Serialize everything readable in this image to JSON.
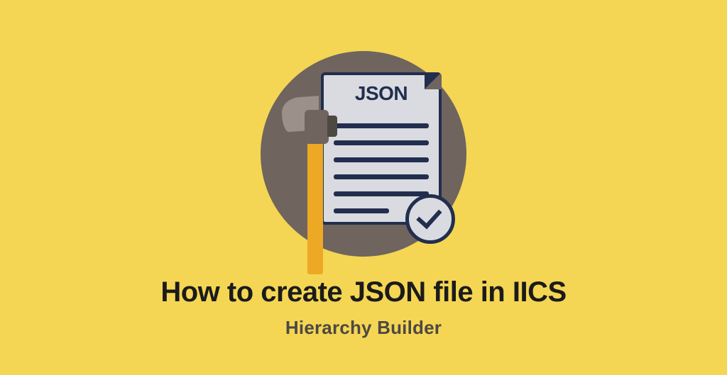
{
  "graphic": {
    "doc_label": "JSON"
  },
  "heading": {
    "title": "How to create JSON file in IICS",
    "subtitle": "Hierarchy Builder"
  }
}
